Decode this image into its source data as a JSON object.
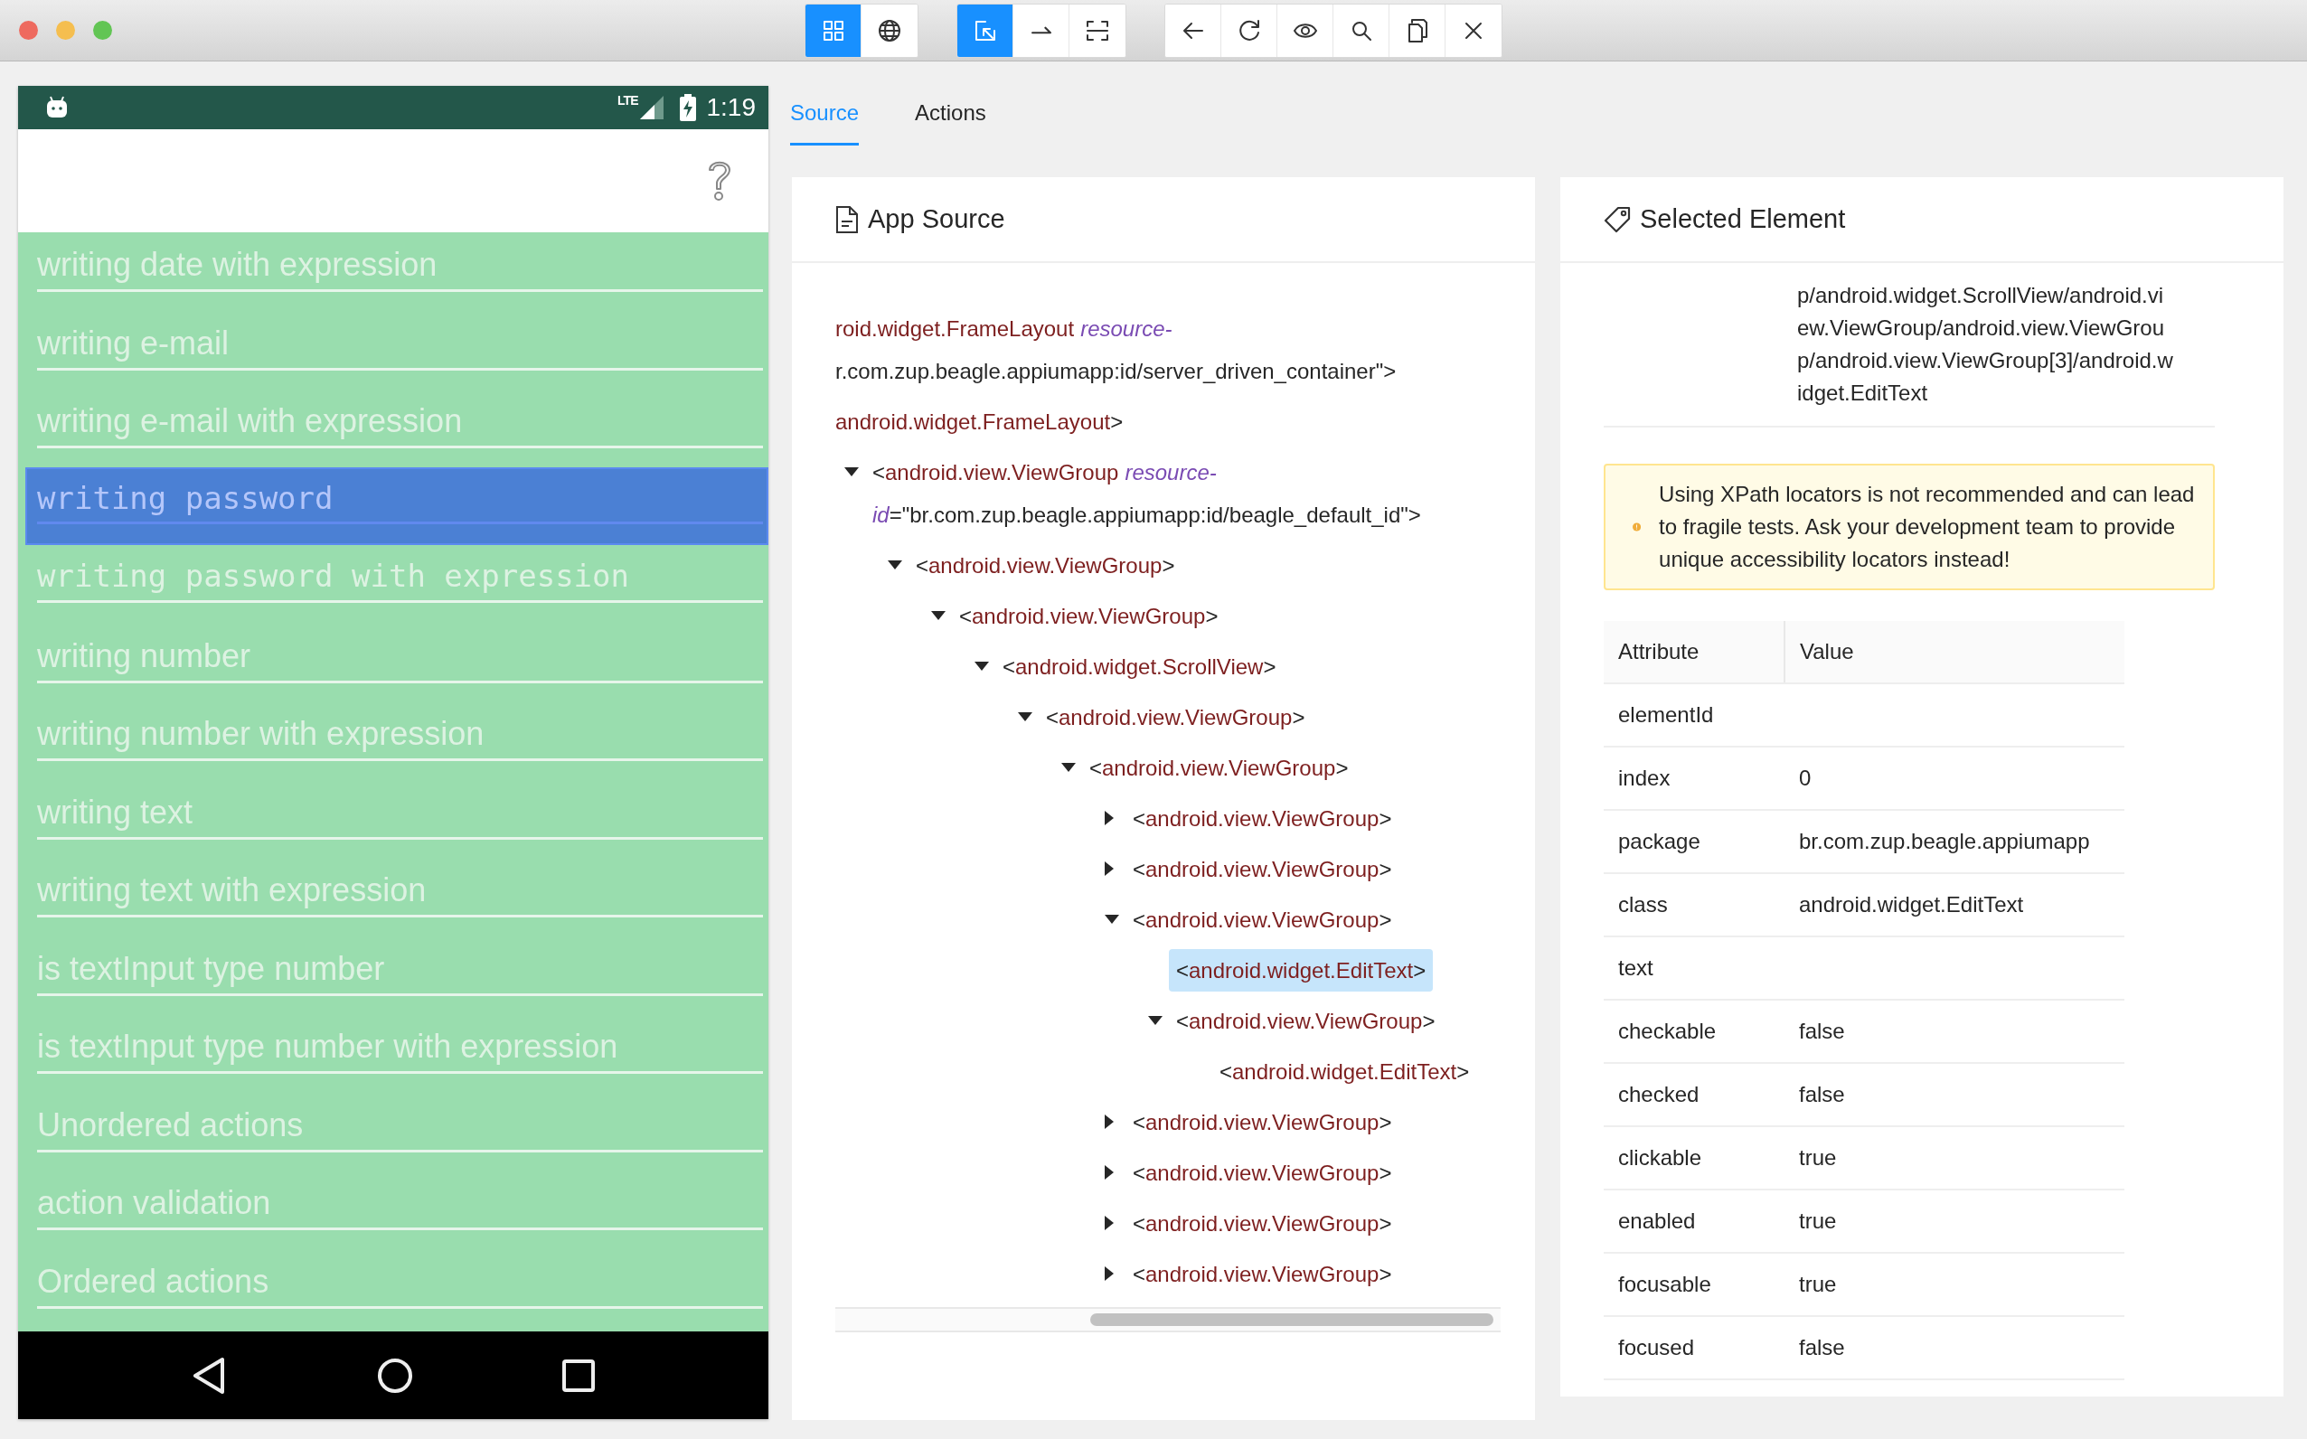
{
  "window": {
    "toolbar": [
      {
        "buttons": [
          {
            "selected": true
          },
          {
            "selected": false
          }
        ]
      },
      {
        "buttons": [
          {
            "selected": true
          },
          {
            "selected": false
          },
          {
            "selected": false
          }
        ]
      },
      {
        "buttons": [
          {
            "selected": false
          },
          {
            "selected": false
          },
          {
            "selected": false
          },
          {
            "selected": false
          },
          {
            "selected": false
          },
          {
            "selected": false
          }
        ]
      }
    ]
  },
  "device": {
    "status_bar": {
      "network": "LTE",
      "time": "1:19"
    },
    "fields": [
      {
        "placeholder": "writing date with expression",
        "kind": "text",
        "selected": false
      },
      {
        "placeholder": "writing e-mail",
        "kind": "text",
        "selected": false
      },
      {
        "placeholder": "writing e-mail with expression",
        "kind": "text",
        "selected": false
      },
      {
        "placeholder": "writing password",
        "kind": "password",
        "selected": true
      },
      {
        "placeholder": "writing password with expression",
        "kind": "password",
        "selected": false
      },
      {
        "placeholder": "writing number",
        "kind": "text",
        "selected": false
      },
      {
        "placeholder": "writing number with expression",
        "kind": "text",
        "selected": false
      },
      {
        "placeholder": "writing text",
        "kind": "text",
        "selected": false
      },
      {
        "placeholder": "writing text with expression",
        "kind": "text",
        "selected": false
      },
      {
        "placeholder": "is textInput type number",
        "kind": "text",
        "selected": false
      },
      {
        "placeholder": "is textInput type number with expression",
        "kind": "text",
        "selected": false
      },
      {
        "placeholder": "Unordered actions",
        "kind": "text",
        "selected": false
      },
      {
        "placeholder": "action validation",
        "kind": "text",
        "selected": false
      },
      {
        "placeholder": "Ordered actions",
        "kind": "text",
        "selected": false
      }
    ]
  },
  "tabs": [
    {
      "label": "Source",
      "selected": true
    },
    {
      "label": "Actions",
      "selected": false
    }
  ],
  "app_source": {
    "title": "App Source",
    "tree": [
      {
        "lines": [
          [
            {
              "kind": "tag",
              "text": "roid.widget.FrameLayout"
            },
            {
              "kind": "attr",
              "text": "resource-"
            }
          ],
          [
            {
              "kind": "value",
              "text": "r.com.zup.beagle.appiumapp:id/server_driven_container\">"
            }
          ]
        ],
        "selected": false,
        "children": [
          {
            "lines": [
              [
                {
                  "kind": "tag",
                  "text": "android.widget.FrameLayout"
                },
                {
                  "kind": "punct",
                  "text": ">"
                }
              ]
            ],
            "selected": false,
            "children": [
              {
                "lines": [
                  [
                    {
                      "kind": "punct",
                      "text": "<"
                    },
                    {
                      "kind": "tag",
                      "text": "android.view.ViewGroup"
                    },
                    {
                      "kind": "attr",
                      "text": "resource-"
                    }
                  ],
                  [
                    {
                      "kind": "attr",
                      "text": "id"
                    },
                    {
                      "kind": "value",
                      "text": "=\"br.com.zup.beagle.appiumapp:id/beagle_default_id\">"
                    }
                  ]
                ],
                "expanded": true,
                "selected": false,
                "children": [
                  {
                    "lines": [
                      [
                        {
                          "kind": "punct",
                          "text": "<"
                        },
                        {
                          "kind": "tag",
                          "text": "android.view.ViewGroup"
                        },
                        {
                          "kind": "punct",
                          "text": ">"
                        }
                      ]
                    ],
                    "expanded": true,
                    "selected": false,
                    "children": [
                      {
                        "lines": [
                          [
                            {
                              "kind": "punct",
                              "text": "<"
                            },
                            {
                              "kind": "tag",
                              "text": "android.view.ViewGroup"
                            },
                            {
                              "kind": "punct",
                              "text": ">"
                            }
                          ]
                        ],
                        "expanded": true,
                        "selected": false,
                        "children": [
                          {
                            "lines": [
                              [
                                {
                                  "kind": "punct",
                                  "text": "<"
                                },
                                {
                                  "kind": "tag",
                                  "text": "android.widget.ScrollView"
                                },
                                {
                                  "kind": "punct",
                                  "text": ">"
                                }
                              ]
                            ],
                            "expanded": true,
                            "selected": false,
                            "children": [
                              {
                                "lines": [
                                  [
                                    {
                                      "kind": "punct",
                                      "text": "<"
                                    },
                                    {
                                      "kind": "tag",
                                      "text": "android.view.ViewGroup"
                                    },
                                    {
                                      "kind": "punct",
                                      "text": ">"
                                    }
                                  ]
                                ],
                                "expanded": true,
                                "selected": false,
                                "children": [
                                  {
                                    "lines": [
                                      [
                                        {
                                          "kind": "punct",
                                          "text": "<"
                                        },
                                        {
                                          "kind": "tag",
                                          "text": "android.view.ViewGroup"
                                        },
                                        {
                                          "kind": "punct",
                                          "text": ">"
                                        }
                                      ]
                                    ],
                                    "expanded": true,
                                    "selected": false,
                                    "children": [
                                      {
                                        "lines": [
                                          [
                                            {
                                              "kind": "punct",
                                              "text": "<"
                                            },
                                            {
                                              "kind": "tag",
                                              "text": "android.view.ViewGroup"
                                            },
                                            {
                                              "kind": "punct",
                                              "text": ">"
                                            }
                                          ]
                                        ],
                                        "expanded": false,
                                        "selected": false
                                      },
                                      {
                                        "lines": [
                                          [
                                            {
                                              "kind": "punct",
                                              "text": "<"
                                            },
                                            {
                                              "kind": "tag",
                                              "text": "android.view.ViewGroup"
                                            },
                                            {
                                              "kind": "punct",
                                              "text": ">"
                                            }
                                          ]
                                        ],
                                        "expanded": false,
                                        "selected": false
                                      },
                                      {
                                        "lines": [
                                          [
                                            {
                                              "kind": "punct",
                                              "text": "<"
                                            },
                                            {
                                              "kind": "tag",
                                              "text": "android.view.ViewGroup"
                                            },
                                            {
                                              "kind": "punct",
                                              "text": ">"
                                            }
                                          ]
                                        ],
                                        "expanded": true,
                                        "selected": false,
                                        "children": [
                                          {
                                            "lines": [
                                              [
                                                {
                                                  "kind": "punct",
                                                  "text": "<"
                                                },
                                                {
                                                  "kind": "tag",
                                                  "text": "android.widget.EditText"
                                                },
                                                {
                                                  "kind": "punct",
                                                  "text": ">"
                                                }
                                              ]
                                            ],
                                            "selected": true
                                          },
                                          {
                                            "lines": [
                                              [
                                                {
                                                  "kind": "punct",
                                                  "text": "<"
                                                },
                                                {
                                                  "kind": "tag",
                                                  "text": "android.view.ViewGroup"
                                                },
                                                {
                                                  "kind": "punct",
                                                  "text": ">"
                                                }
                                              ]
                                            ],
                                            "expanded": true,
                                            "selected": false,
                                            "children": [
                                              {
                                                "lines": [
                                                  [
                                                    {
                                                      "kind": "punct",
                                                      "text": "<"
                                                    },
                                                    {
                                                      "kind": "tag",
                                                      "text": "android.widget.EditText"
                                                    },
                                                    {
                                                      "kind": "punct",
                                                      "text": ">"
                                                    }
                                                  ]
                                                ],
                                                "selected": false
                                              }
                                            ]
                                          }
                                        ]
                                      },
                                      {
                                        "lines": [
                                          [
                                            {
                                              "kind": "punct",
                                              "text": "<"
                                            },
                                            {
                                              "kind": "tag",
                                              "text": "android.view.ViewGroup"
                                            },
                                            {
                                              "kind": "punct",
                                              "text": ">"
                                            }
                                          ]
                                        ],
                                        "expanded": false,
                                        "selected": false
                                      },
                                      {
                                        "lines": [
                                          [
                                            {
                                              "kind": "punct",
                                              "text": "<"
                                            },
                                            {
                                              "kind": "tag",
                                              "text": "android.view.ViewGroup"
                                            },
                                            {
                                              "kind": "punct",
                                              "text": ">"
                                            }
                                          ]
                                        ],
                                        "expanded": false,
                                        "selected": false
                                      },
                                      {
                                        "lines": [
                                          [
                                            {
                                              "kind": "punct",
                                              "text": "<"
                                            },
                                            {
                                              "kind": "tag",
                                              "text": "android.view.ViewGroup"
                                            },
                                            {
                                              "kind": "punct",
                                              "text": ">"
                                            }
                                          ]
                                        ],
                                        "expanded": false,
                                        "selected": false
                                      },
                                      {
                                        "lines": [
                                          [
                                            {
                                              "kind": "punct",
                                              "text": "<"
                                            },
                                            {
                                              "kind": "tag",
                                              "text": "android.view.ViewGroup"
                                            },
                                            {
                                              "kind": "punct",
                                              "text": ">"
                                            }
                                          ]
                                        ],
                                        "expanded": false,
                                        "selected": false
                                      }
                                    ]
                                  }
                                ]
                              }
                            ]
                          }
                        ]
                      }
                    ]
                  }
                ]
              }
            ]
          }
        ]
      }
    ]
  },
  "selected_element": {
    "title": "Selected Element",
    "xpath_lines": [
      "p/android.widget.ScrollView/android.vi",
      "ew.ViewGroup/android.view.ViewGrou",
      "p/android.view.ViewGroup[3]/android.w",
      "idget.EditText"
    ],
    "warning": "Using XPath locators is not recommended and can lead to fragile tests. Ask your development team to provide unique accessibility locators instead!",
    "table": {
      "columns": [
        "Attribute",
        "Value"
      ],
      "rows": [
        {
          "attribute": "elementId"
        },
        {
          "attribute": "index",
          "value": "0"
        },
        {
          "attribute": "package",
          "value": "br.com.zup.beagle.appiumapp"
        },
        {
          "attribute": "class",
          "value": "android.widget.EditText"
        },
        {
          "attribute": "text"
        },
        {
          "attribute": "checkable",
          "value": "false"
        },
        {
          "attribute": "checked",
          "value": "false"
        },
        {
          "attribute": "clickable",
          "value": "true"
        },
        {
          "attribute": "enabled",
          "value": "true"
        },
        {
          "attribute": "focusable",
          "value": "true"
        },
        {
          "attribute": "focused",
          "value": "false"
        }
      ]
    }
  }
}
